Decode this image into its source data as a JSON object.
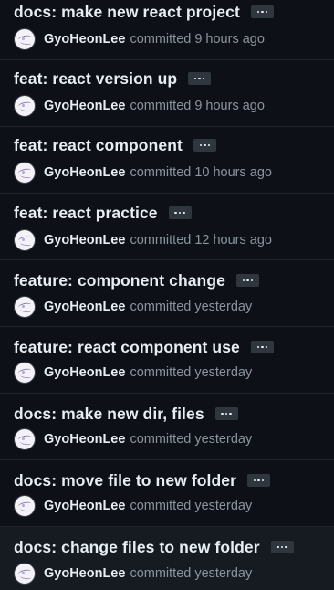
{
  "commits": [
    {
      "title": "docs: make new react project",
      "author": "GyoHeonLee",
      "action": "committed",
      "time": "9 hours ago"
    },
    {
      "title": "feat: react version up",
      "author": "GyoHeonLee",
      "action": "committed",
      "time": "9 hours ago"
    },
    {
      "title": "feat: react component",
      "author": "GyoHeonLee",
      "action": "committed",
      "time": "10 hours ago"
    },
    {
      "title": "feat: react practice",
      "author": "GyoHeonLee",
      "action": "committed",
      "time": "12 hours ago"
    },
    {
      "title": "feature: component change",
      "author": "GyoHeonLee",
      "action": "committed",
      "time": "yesterday"
    },
    {
      "title": "feature: react component use",
      "author": "GyoHeonLee",
      "action": "committed",
      "time": "yesterday"
    },
    {
      "title": "docs: make new dir, files",
      "author": "GyoHeonLee",
      "action": "committed",
      "time": "yesterday"
    },
    {
      "title": "docs: move file to new folder",
      "author": "GyoHeonLee",
      "action": "committed",
      "time": "yesterday"
    },
    {
      "title": "docs: change files to new folder",
      "author": "GyoHeonLee",
      "action": "committed",
      "time": "yesterday"
    }
  ],
  "icons": {
    "expand": "ellipsis-icon",
    "avatar": "user-avatar"
  },
  "colors": {
    "background": "#0d1117",
    "row_hover": "#161b22",
    "divider": "#21262d",
    "title_text": "#e6edf3",
    "muted_text": "#8b949e",
    "ellipsis_bg": "#30363d"
  }
}
